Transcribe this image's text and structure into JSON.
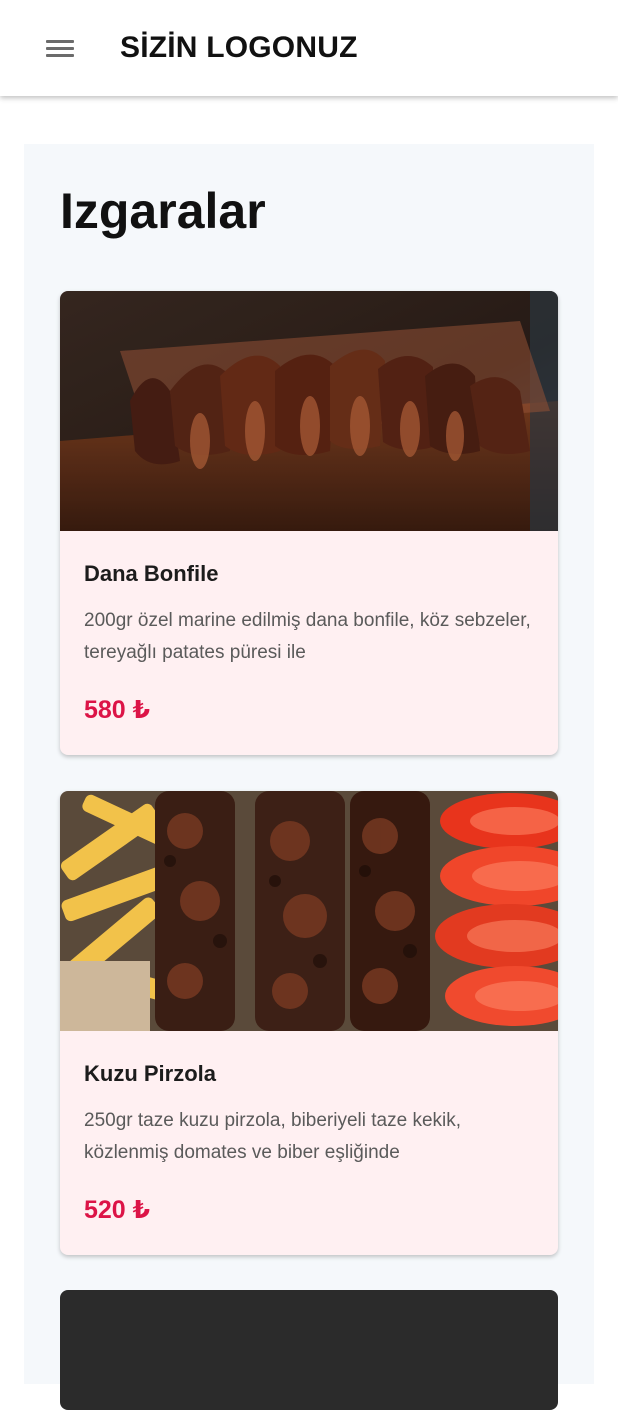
{
  "header": {
    "logo": "SİZİN LOGONUZ",
    "menu_icon": "hamburger-menu-icon"
  },
  "section": {
    "title": "Izgaralar"
  },
  "items": [
    {
      "name": "Dana Bonfile",
      "description": "200gr özel marine edilmiş dana bonfile, köz sebzeler, tereyağlı patates püresi ile",
      "price": "580 ₺"
    },
    {
      "name": "Kuzu Pirzola",
      "description": "250gr taze kuzu pirzola, biberiyeli taze kekik, közlenmiş domates ve biber eşliğinde",
      "price": "520 ₺"
    }
  ],
  "colors": {
    "price": "#dc1447",
    "card_bg": "#fff0f2",
    "section_bg": "#f5f8fb"
  }
}
